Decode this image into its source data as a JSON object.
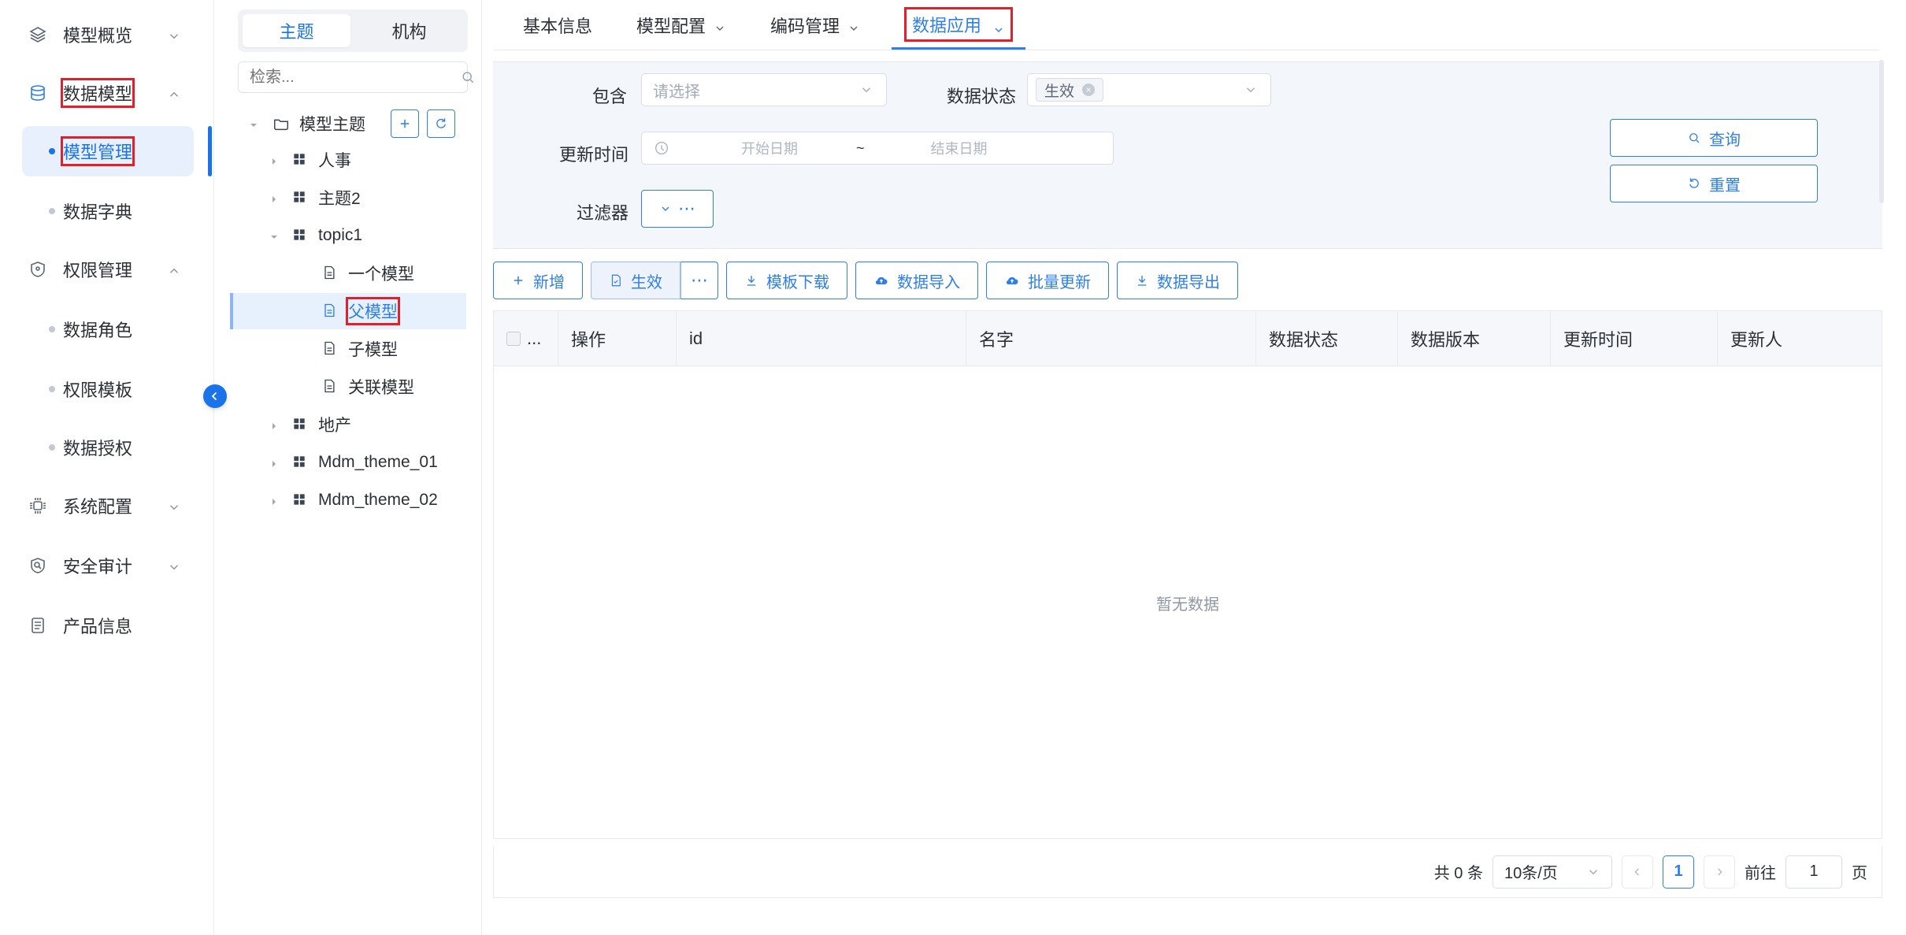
{
  "nav": {
    "items": [
      {
        "label": "模型概览",
        "icon": "layers-icon",
        "expanded": false
      },
      {
        "label": "数据模型",
        "icon": "database-icon",
        "expanded": true
      },
      {
        "label": "权限管理",
        "icon": "shield-icon",
        "expanded": true
      },
      {
        "label": "系统配置",
        "icon": "chip-icon",
        "expanded": false
      },
      {
        "label": "安全审计",
        "icon": "shield-search-icon",
        "expanded": false
      },
      {
        "label": "产品信息",
        "icon": "document-list-icon"
      }
    ],
    "sub_data_model": [
      "模型管理",
      "数据字典"
    ],
    "sub_permission": [
      "数据角色",
      "权限模板",
      "数据授权"
    ],
    "active_sub": "模型管理"
  },
  "tree": {
    "tabs": [
      "主题",
      "机构"
    ],
    "active_tab": "主题",
    "search_placeholder": "检索...",
    "root": "模型主题",
    "nodes": [
      {
        "label": "人事",
        "level": 1,
        "type": "group",
        "expanded": false
      },
      {
        "label": "主题2",
        "level": 1,
        "type": "group",
        "expanded": false
      },
      {
        "label": "topic1",
        "level": 1,
        "type": "group",
        "expanded": true
      },
      {
        "label": "一个模型",
        "level": 2,
        "type": "doc"
      },
      {
        "label": "父模型",
        "level": 2,
        "type": "doc",
        "selected": true
      },
      {
        "label": "子模型",
        "level": 2,
        "type": "doc"
      },
      {
        "label": "关联模型",
        "level": 2,
        "type": "doc"
      },
      {
        "label": "地产",
        "level": 1,
        "type": "group",
        "expanded": false
      },
      {
        "label": "Mdm_theme_01",
        "level": 1,
        "type": "group",
        "expanded": false
      },
      {
        "label": "Mdm_theme_02",
        "level": 1,
        "type": "group",
        "expanded": false
      }
    ]
  },
  "main": {
    "tabs": [
      "基本信息",
      "模型配置",
      "编码管理",
      "数据应用"
    ],
    "active_tab": "数据应用",
    "filters": {
      "contains_label": "包含",
      "contains_placeholder": "请选择",
      "status_label": "数据状态",
      "status_tag": "生效",
      "update_time_label": "更新时间",
      "start_placeholder": "开始日期",
      "range_sep": "~",
      "end_placeholder": "结束日期",
      "filter_label": "过滤器",
      "query_btn": "查询",
      "reset_btn": "重置"
    },
    "toolbar": {
      "add": "新增",
      "effective": "生效",
      "template_download": "模板下载",
      "data_import": "数据导入",
      "batch_update": "批量更新",
      "data_export": "数据导出"
    },
    "table": {
      "select_label": "...",
      "columns": [
        "操作",
        "id",
        "名字",
        "数据状态",
        "数据版本",
        "更新时间",
        "更新人"
      ],
      "empty_text": "暂无数据"
    },
    "pagination": {
      "total": "共 0 条",
      "page_size": "10条/页",
      "current_page": "1",
      "goto_label": "前往",
      "goto_value": "1",
      "page_suffix": "页"
    }
  }
}
